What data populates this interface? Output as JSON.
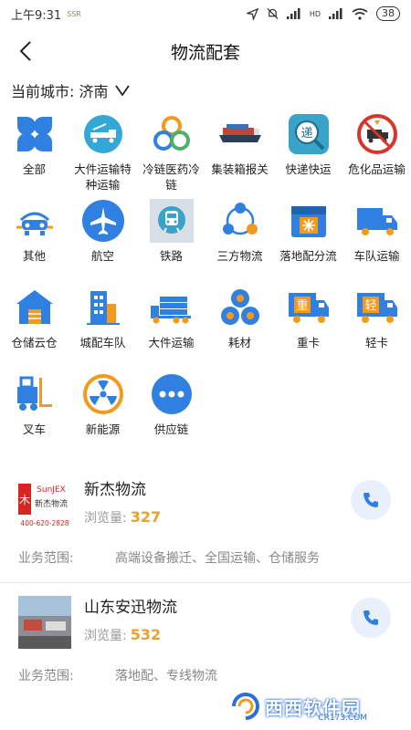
{
  "status_bar": {
    "time": "上午9:31",
    "small_tag": "SSR",
    "signal_label": "HD",
    "battery": "38"
  },
  "header": {
    "title": "物流配套"
  },
  "city": {
    "label": "当前城市: 济南"
  },
  "categories": [
    {
      "label": "全部",
      "icon": "clover-icon"
    },
    {
      "label": "大件运输特种运输",
      "icon": "heavy-truck-icon"
    },
    {
      "label": "冷链医药冷链",
      "icon": "cold-chain-rings-icon"
    },
    {
      "label": "集装箱报关",
      "icon": "container-ship-icon"
    },
    {
      "label": "快递快运",
      "icon": "express-search-icon"
    },
    {
      "label": "危化品运输",
      "icon": "hazardous-truck-icon"
    },
    {
      "label": "其他",
      "icon": "car-wrench-icon"
    },
    {
      "label": "航空",
      "icon": "airplane-icon"
    },
    {
      "label": "铁路",
      "icon": "train-icon"
    },
    {
      "label": "三方物流",
      "icon": "network-nodes-icon"
    },
    {
      "label": "落地配分流",
      "icon": "box-snowflake-icon"
    },
    {
      "label": "车队运输",
      "icon": "truck-icon"
    },
    {
      "label": "仓储云仓",
      "icon": "warehouse-icon"
    },
    {
      "label": "城配车队",
      "icon": "city-building-icon"
    },
    {
      "label": "大件运输",
      "icon": "large-cargo-truck-icon"
    },
    {
      "label": "耗材",
      "icon": "rolls-icon"
    },
    {
      "label": "重卡",
      "icon": "heavy-truck-zhong-icon"
    },
    {
      "label": "轻卡",
      "icon": "light-truck-qing-icon"
    },
    {
      "label": "叉车",
      "icon": "forklift-icon"
    },
    {
      "label": "新能源",
      "icon": "radiation-icon"
    },
    {
      "label": "供应链",
      "icon": "more-dots-icon"
    }
  ],
  "companies": [
    {
      "name": "新杰物流",
      "views_label": "浏览量:",
      "views": "327",
      "scope_label": "业务范围:",
      "scope": "高端设备搬迁、全国运输、仓储服务",
      "logo_brand": "SunJEX",
      "logo_cn": "新杰物流",
      "logo_phone": "400-620-2828"
    },
    {
      "name": "山东安迅物流",
      "views_label": "浏览量:",
      "views": "532",
      "scope_label": "业务范围:",
      "scope": "落地配、专线物流"
    }
  ],
  "watermark": {
    "text": "西西软件园",
    "url": "CR173.COM"
  },
  "colors": {
    "blue": "#2f80e0",
    "orange": "#f39a1e",
    "accent_count": "#e8a12c"
  }
}
